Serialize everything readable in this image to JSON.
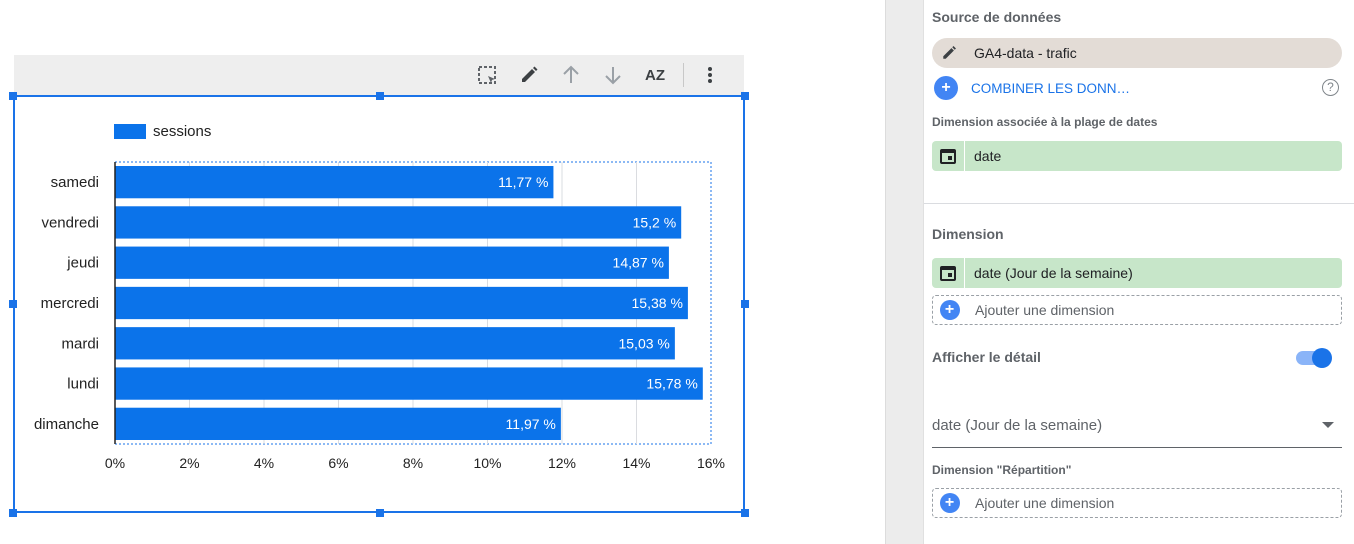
{
  "toolbar": {
    "icons": [
      "select-area-icon",
      "pencil-icon",
      "arrow-up-icon",
      "arrow-down-icon",
      "sort-az-icon",
      "more-vert-icon"
    ],
    "sort_label": "AZ"
  },
  "chart_data": {
    "type": "bar",
    "orientation": "horizontal",
    "categories": [
      "samedi",
      "vendredi",
      "jeudi",
      "mercredi",
      "mardi",
      "lundi",
      "dimanche"
    ],
    "series": [
      {
        "name": "sessions",
        "values": [
          11.77,
          15.2,
          14.87,
          15.38,
          15.03,
          15.78,
          11.97
        ],
        "color": "#0b73ea"
      }
    ],
    "data_labels": [
      "11,77 %",
      "15,2 %",
      "14,87 %",
      "15,38 %",
      "15,03 %",
      "15,78 %",
      "11,97 %"
    ],
    "xlim": [
      0,
      16
    ],
    "x_ticks": [
      "0%",
      "2%",
      "4%",
      "6%",
      "8%",
      "10%",
      "12%",
      "14%",
      "16%"
    ],
    "grid": true,
    "legend_position": "top-left"
  },
  "panel": {
    "source_title": "Source de données",
    "source_name": "GA4-data - trafic",
    "combine_label": "COMBINER LES DONN…",
    "date_range_dim_title": "Dimension associée à la plage de dates",
    "date_range_dim_value": "date",
    "dimension_title": "Dimension",
    "dimension_value": "date (Jour de la semaine)",
    "add_dimension_label": "Ajouter une dimension",
    "drilldown_title": "Afficher le détail",
    "drilldown_enabled": true,
    "drilldown_select": "date (Jour de la semaine)",
    "breakdown_title": "Dimension \"Répartition\"",
    "breakdown_add_label": "Ajouter une dimension"
  },
  "colors": {
    "accent": "#1a73e8",
    "bar": "#0b73ea",
    "dimension_chip": "#c7e6c9",
    "source_chip": "#e3dcd6"
  }
}
